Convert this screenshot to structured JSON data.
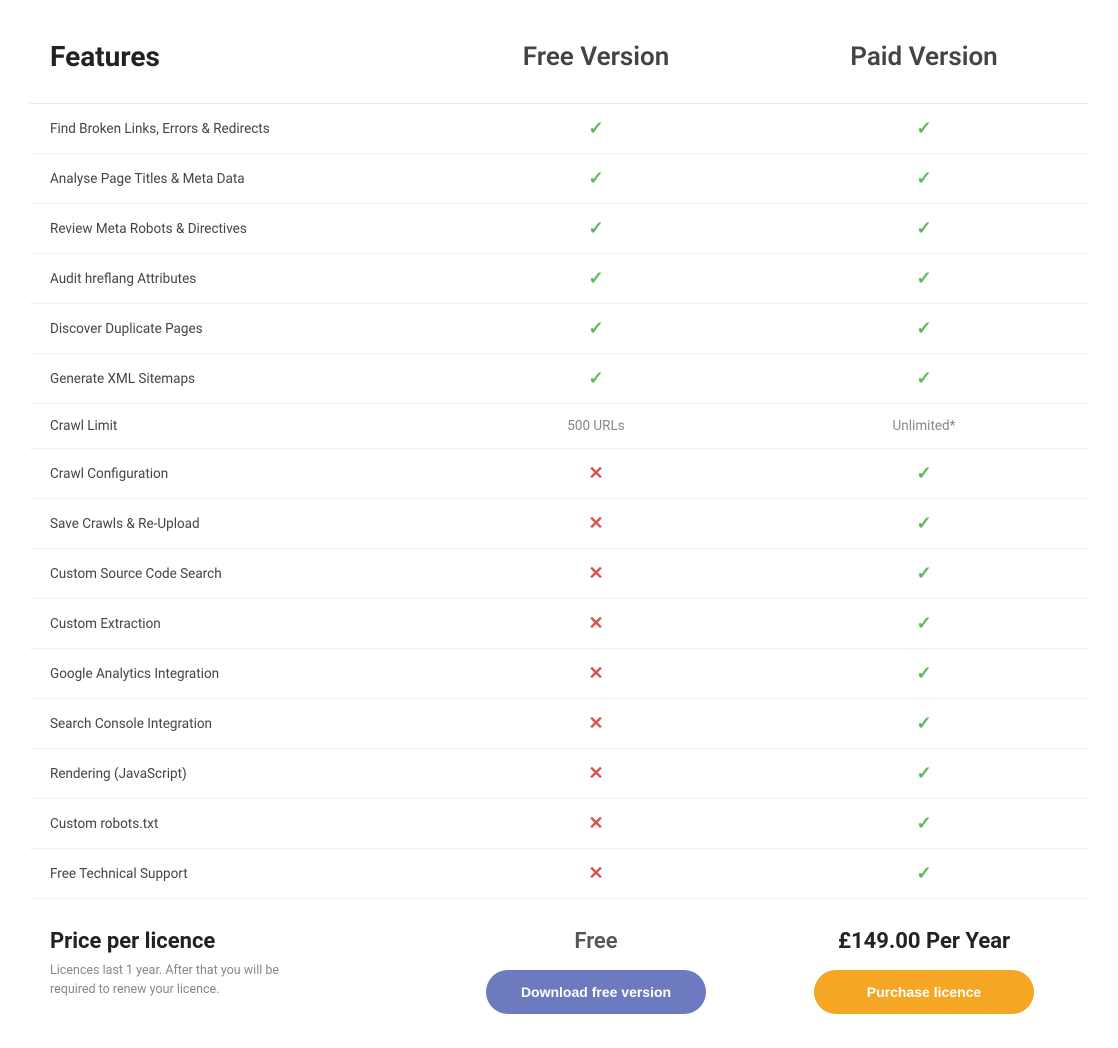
{
  "header": {
    "features_label": "Features",
    "free_version_label": "Free Version",
    "paid_version_label": "Paid Version"
  },
  "rows": [
    {
      "feature": "Find Broken Links, Errors & Redirects",
      "free": "check",
      "paid": "check"
    },
    {
      "feature": "Analyse Page Titles & Meta Data",
      "free": "check",
      "paid": "check"
    },
    {
      "feature": "Review Meta Robots & Directives",
      "free": "check",
      "paid": "check"
    },
    {
      "feature": "Audit hreflang Attributes",
      "free": "check",
      "paid": "check"
    },
    {
      "feature": "Discover Duplicate Pages",
      "free": "check",
      "paid": "check"
    },
    {
      "feature": "Generate XML Sitemaps",
      "free": "check",
      "paid": "check"
    },
    {
      "feature": "Crawl Limit",
      "free": "500 URLs",
      "paid": "Unlimited*"
    },
    {
      "feature": "Crawl Configuration",
      "free": "cross",
      "paid": "check"
    },
    {
      "feature": "Save Crawls & Re-Upload",
      "free": "cross",
      "paid": "check"
    },
    {
      "feature": "Custom Source Code Search",
      "free": "cross",
      "paid": "check"
    },
    {
      "feature": "Custom Extraction",
      "free": "cross",
      "paid": "check"
    },
    {
      "feature": "Google Analytics Integration",
      "free": "cross",
      "paid": "check"
    },
    {
      "feature": "Search Console Integration",
      "free": "cross",
      "paid": "check"
    },
    {
      "feature": "Rendering (JavaScript)",
      "free": "cross",
      "paid": "check"
    },
    {
      "feature": "Custom robots.txt",
      "free": "cross",
      "paid": "check"
    },
    {
      "feature": "Free Technical Support",
      "free": "cross",
      "paid": "check"
    }
  ],
  "footer": {
    "price_label": "Price per licence",
    "price_note": "Licences last 1 year. After that you will be required to renew your licence.",
    "free_price": "Free",
    "paid_price": "£149.00 Per Year",
    "download_btn": "Download free version",
    "purchase_btn": "Purchase licence"
  },
  "icons": {
    "check": "✓",
    "cross": "✕"
  }
}
